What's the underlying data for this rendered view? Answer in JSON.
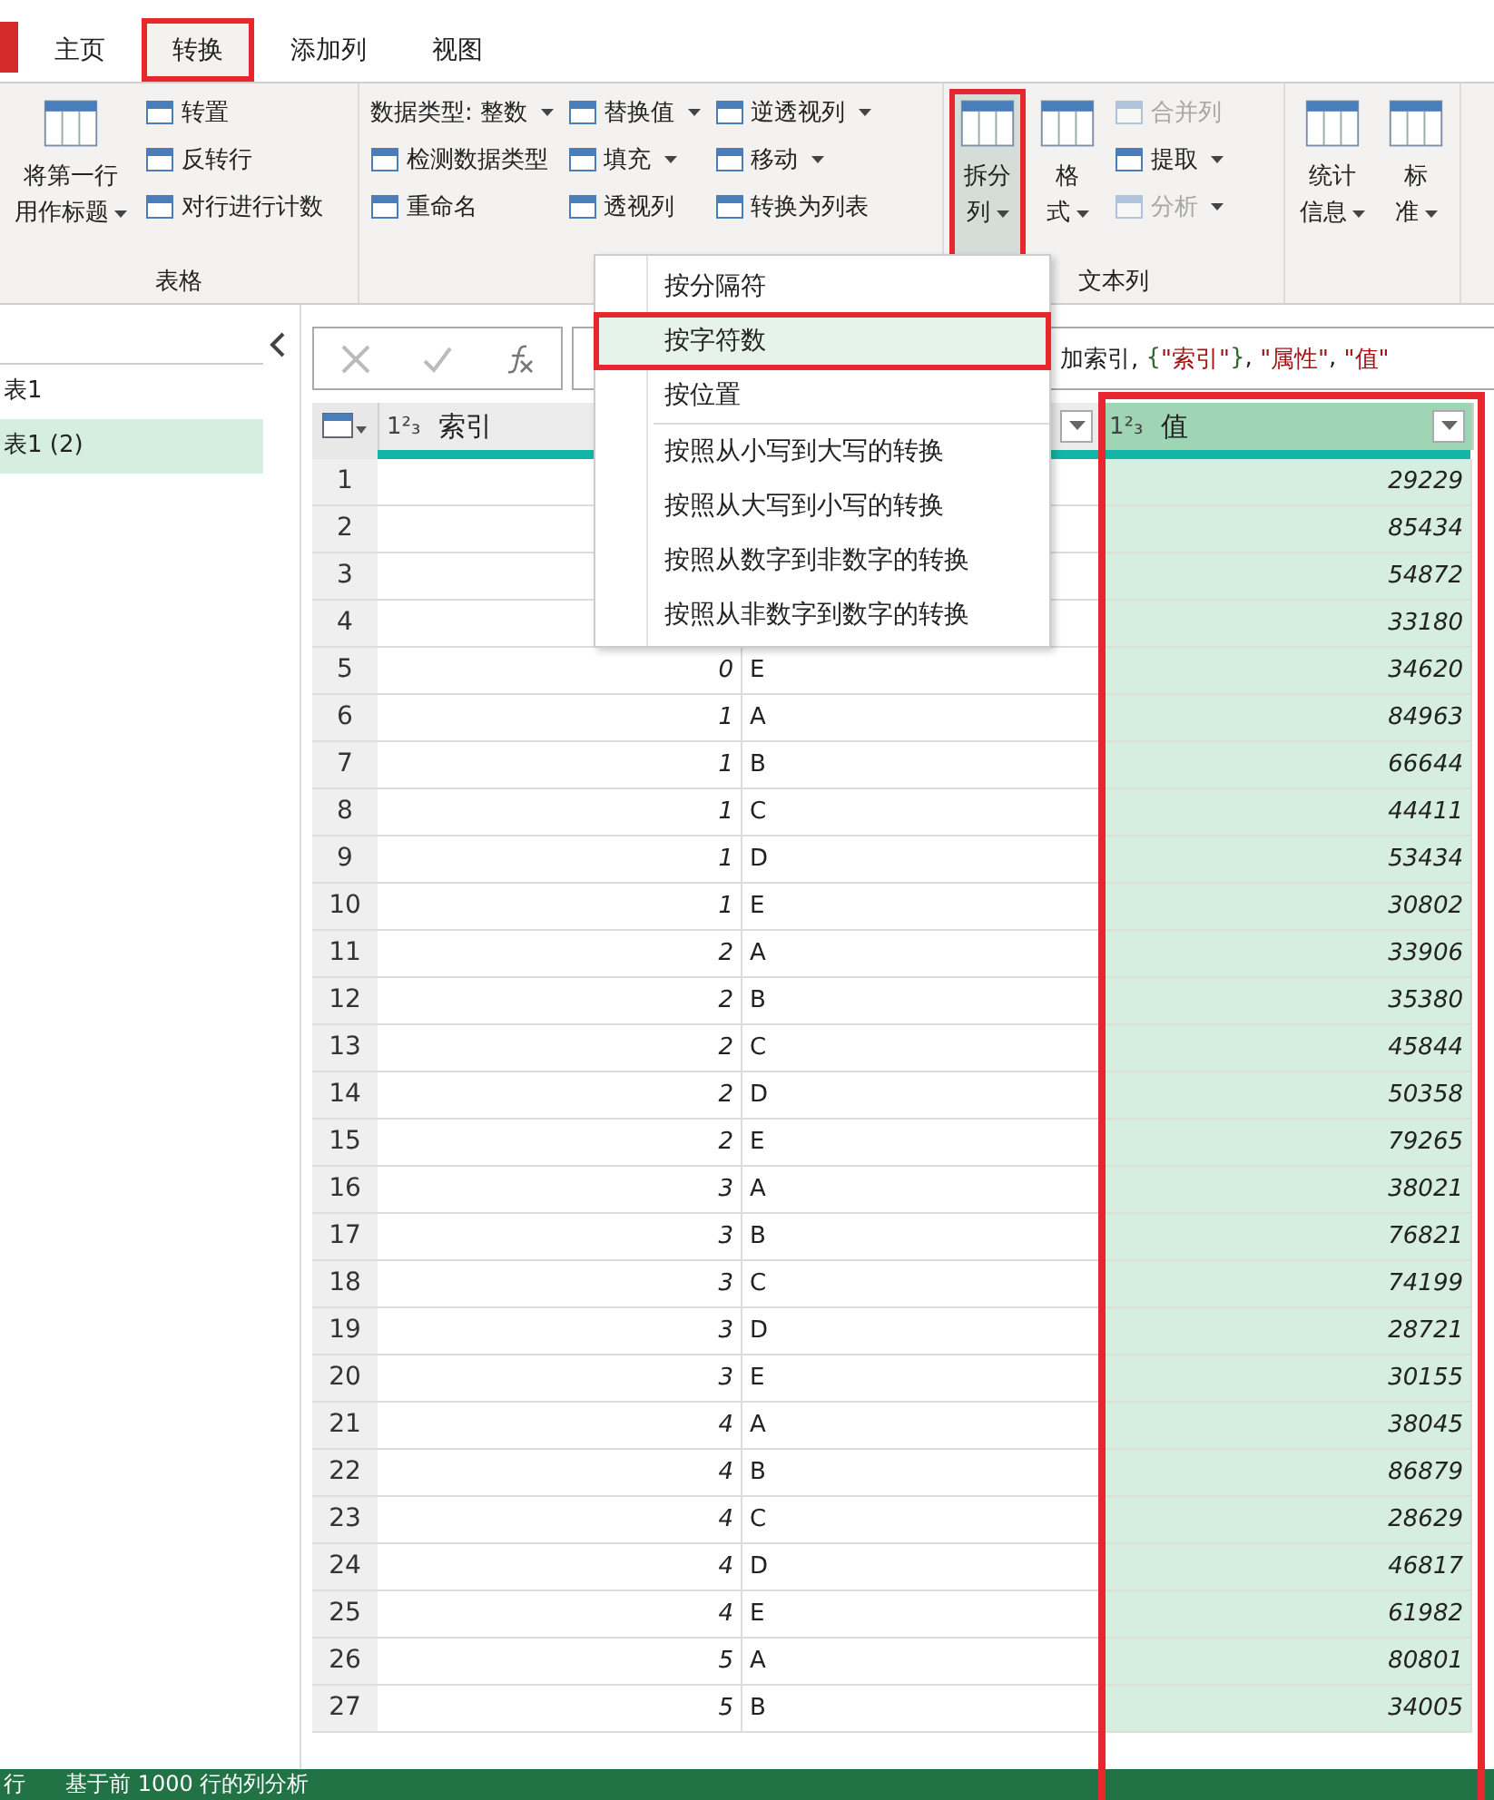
{
  "tabs": [
    {
      "label": "主页",
      "selected": false,
      "marked": false
    },
    {
      "label": "转换",
      "selected": true,
      "marked": true
    },
    {
      "label": "添加列",
      "selected": false,
      "marked": false
    },
    {
      "label": "视图",
      "selected": false,
      "marked": false
    }
  ],
  "ribbon": {
    "groups": [
      {
        "label": "表格",
        "columns": [
          [
            {
              "kind": "large",
              "lines": [
                "将第一行",
                "用作标题"
              ],
              "dropdown": true,
              "marked": false
            }
          ],
          [
            {
              "kind": "small",
              "lines": [
                "转置"
              ],
              "dropdown": false,
              "disabled": false
            },
            {
              "kind": "small",
              "lines": [
                "反转行"
              ],
              "dropdown": false,
              "disabled": false
            },
            {
              "kind": "small",
              "lines": [
                "对行进行计数"
              ],
              "dropdown": false,
              "disabled": false
            }
          ]
        ]
      },
      {
        "columns": [
          [
            {
              "kind": "small",
              "lines": [
                "数据类型: 整数"
              ],
              "dropdown": true,
              "disabled": false,
              "noicon": true
            },
            {
              "kind": "small",
              "lines": [
                "检测数据类型"
              ],
              "dropdown": false,
              "disabled": false
            },
            {
              "kind": "small",
              "lines": [
                "重命名"
              ],
              "dropdown": false,
              "disabled": false
            }
          ],
          [
            {
              "kind": "small",
              "lines": [
                "替换值"
              ],
              "dropdown": true,
              "disabled": false
            },
            {
              "kind": "small",
              "lines": [
                "填充"
              ],
              "dropdown": true,
              "disabled": false
            },
            {
              "kind": "small",
              "lines": [
                "透视列"
              ],
              "dropdown": false,
              "disabled": false
            }
          ],
          [
            {
              "kind": "small",
              "lines": [
                "逆透视列"
              ],
              "dropdown": true,
              "disabled": false
            },
            {
              "kind": "small",
              "lines": [
                "移动"
              ],
              "dropdown": true,
              "disabled": false
            },
            {
              "kind": "small",
              "lines": [
                "转换为列表"
              ],
              "dropdown": false,
              "disabled": false
            }
          ]
        ]
      },
      {
        "label": "文本列",
        "columns": [
          [
            {
              "kind": "large",
              "lines": [
                "拆分",
                "列"
              ],
              "dropdown": true,
              "marked": true
            }
          ],
          [
            {
              "kind": "large",
              "lines": [
                "格",
                "式"
              ],
              "dropdown": true,
              "marked": false
            }
          ],
          [
            {
              "kind": "small",
              "lines": [
                "合并列"
              ],
              "dropdown": false,
              "disabled": true
            },
            {
              "kind": "small",
              "lines": [
                "提取"
              ],
              "dropdown": true,
              "disabled": false
            },
            {
              "kind": "small",
              "lines": [
                "分析"
              ],
              "dropdown": true,
              "disabled": true
            }
          ]
        ]
      },
      {
        "columns": [
          [
            {
              "kind": "large",
              "lines": [
                "统计",
                "信息"
              ],
              "dropdown": true,
              "marked": false
            }
          ],
          [
            {
              "kind": "large",
              "lines": [
                "标",
                "准"
              ],
              "dropdown": true,
              "marked": false
            }
          ]
        ]
      }
    ]
  },
  "queries": [
    {
      "label": "表1",
      "selected": false
    },
    {
      "label": "表1 (2)",
      "selected": true
    }
  ],
  "formula": [
    {
      "text": "加索引, ",
      "kind": "plain"
    },
    {
      "text": "{",
      "kind": "brace"
    },
    {
      "text": "\"索引\"",
      "kind": "string"
    },
    {
      "text": "}",
      "kind": "brace"
    },
    {
      "text": ", ",
      "kind": "plain"
    },
    {
      "text": "\"属性\"",
      "kind": "string"
    },
    {
      "text": ", ",
      "kind": "plain"
    },
    {
      "text": "\"值\"",
      "kind": "string"
    }
  ],
  "split_menu": [
    {
      "label": "按分隔符",
      "marked": false,
      "hovered": false
    },
    {
      "label": "按字符数",
      "marked": true,
      "hovered": true
    },
    {
      "label": "按位置",
      "marked": false,
      "hovered": false
    },
    {
      "kind": "separator"
    },
    {
      "label": "按照从小写到大写的转换",
      "marked": false,
      "hovered": false
    },
    {
      "label": "按照从大写到小写的转换",
      "marked": false,
      "hovered": false
    },
    {
      "label": "按照从数字到非数字的转换",
      "marked": false,
      "hovered": false
    },
    {
      "label": "按照从非数字到数字的转换",
      "marked": false,
      "hovered": false
    }
  ],
  "table": {
    "columns": [
      {
        "type": "1²₃",
        "label": "索引",
        "selected": false
      },
      {
        "selected": false
      },
      {
        "type": "1²₃",
        "label": "值",
        "selected": true,
        "marked": true
      }
    ],
    "rows": [
      {
        "n": "1",
        "value": "29229"
      },
      {
        "n": "2",
        "value": "85434"
      },
      {
        "n": "3",
        "value": "54872"
      },
      {
        "n": "4",
        "value": "33180"
      },
      {
        "n": "5",
        "index": "0",
        "attribute": "E",
        "value": "34620"
      },
      {
        "n": "6",
        "index": "1",
        "attribute": "A",
        "value": "84963"
      },
      {
        "n": "7",
        "index": "1",
        "attribute": "B",
        "value": "66644"
      },
      {
        "n": "8",
        "index": "1",
        "attribute": "C",
        "value": "44411"
      },
      {
        "n": "9",
        "index": "1",
        "attribute": "D",
        "value": "53434"
      },
      {
        "n": "10",
        "index": "1",
        "attribute": "E",
        "value": "30802"
      },
      {
        "n": "11",
        "index": "2",
        "attribute": "A",
        "value": "33906"
      },
      {
        "n": "12",
        "index": "2",
        "attribute": "B",
        "value": "35380"
      },
      {
        "n": "13",
        "index": "2",
        "attribute": "C",
        "value": "45844"
      },
      {
        "n": "14",
        "index": "2",
        "attribute": "D",
        "value": "50358"
      },
      {
        "n": "15",
        "index": "2",
        "attribute": "E",
        "value": "79265"
      },
      {
        "n": "16",
        "index": "3",
        "attribute": "A",
        "value": "38021"
      },
      {
        "n": "17",
        "index": "3",
        "attribute": "B",
        "value": "76821"
      },
      {
        "n": "18",
        "index": "3",
        "attribute": "C",
        "value": "74199"
      },
      {
        "n": "19",
        "index": "3",
        "attribute": "D",
        "value": "28721"
      },
      {
        "n": "20",
        "index": "3",
        "attribute": "E",
        "value": "30155"
      },
      {
        "n": "21",
        "index": "4",
        "attribute": "A",
        "value": "38045"
      },
      {
        "n": "22",
        "index": "4",
        "attribute": "B",
        "value": "86879"
      },
      {
        "n": "23",
        "index": "4",
        "attribute": "C",
        "value": "28629"
      },
      {
        "n": "24",
        "index": "4",
        "attribute": "D",
        "value": "46817"
      },
      {
        "n": "25",
        "index": "4",
        "attribute": "E",
        "value": "61982"
      },
      {
        "n": "26",
        "index": "5",
        "attribute": "A",
        "value": "80801"
      },
      {
        "n": "27",
        "index": "5",
        "attribute": "B",
        "value": "34005"
      }
    ]
  },
  "status_bar": [
    "行",
    "基于前 1000 行的列分析"
  ]
}
